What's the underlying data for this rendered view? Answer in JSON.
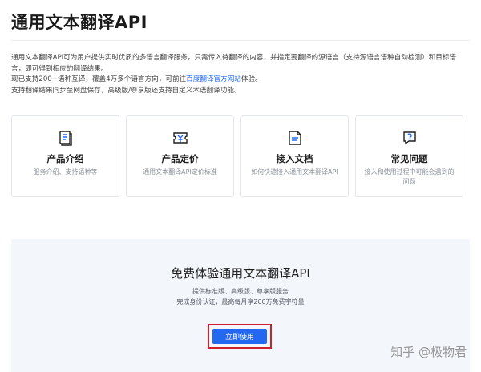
{
  "header": {
    "title": "通用文本翻译API"
  },
  "intro": {
    "line1": "通用文本翻译API可为用户提供实时优质的多语言翻译服务，只需传入待翻译的内容，并指定要翻译的源语言（支持源语言语种自动检测）和目标语言，即可得到相应的翻译结果。",
    "line2_before": "现已支持200+语种互译，覆盖4万多个语言方向，可前往",
    "line2_link": "百度翻译官方网站",
    "line2_after": "体验。",
    "line3": "支持翻译结果同步至网盘保存，高级版/尊享版还支持自定义术语翻译功能。"
  },
  "cards": [
    {
      "title": "产品介绍",
      "desc": "服务介绍、支持语种等",
      "icon": "book-icon"
    },
    {
      "title": "产品定价",
      "desc": "通用文本翻译API定价标准",
      "icon": "price-tag-icon"
    },
    {
      "title": "接入文档",
      "desc": "如何快速接入通用文本翻译API",
      "icon": "document-icon"
    },
    {
      "title": "常见问题",
      "desc": "接入和使用过程中可能会遇到的问题",
      "icon": "question-icon"
    }
  ],
  "promo": {
    "title": "免费体验通用文本翻译API",
    "sub1": "提供标准版、高级版、尊享版服务",
    "sub2": "完成身份认证，最高每月享200万免费字符量",
    "button_label": "立即使用"
  },
  "watermark": "知乎 @极物君",
  "colors": {
    "accent": "#2468f2",
    "highlight_border": "#d0202a",
    "promo_background": "#f3f6fa"
  }
}
